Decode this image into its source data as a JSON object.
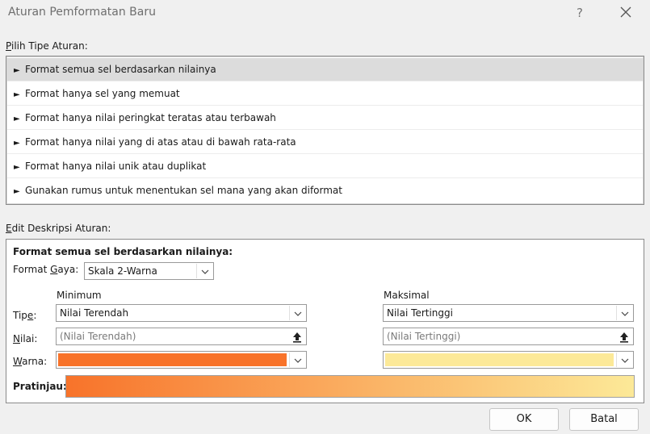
{
  "window": {
    "title": "Aturan Pemformatan Baru",
    "help_label": "?"
  },
  "rule_type": {
    "label_accel": "P",
    "label_rest": "ilih Tipe Aturan:",
    "items": [
      {
        "label": "Format semua sel berdasarkan nilainya",
        "selected": true
      },
      {
        "label": "Format hanya sel yang memuat",
        "selected": false
      },
      {
        "label": "Format hanya nilai peringkat teratas atau terbawah",
        "selected": false
      },
      {
        "label": "Format hanya nilai yang di atas atau di bawah rata-rata",
        "selected": false
      },
      {
        "label": "Format hanya nilai unik atau duplikat",
        "selected": false
      },
      {
        "label": "Gunakan rumus untuk menentukan sel mana yang akan diformat",
        "selected": false
      }
    ],
    "arrow_glyph": "►"
  },
  "description": {
    "label_accel": "E",
    "label_rest": "dit Deskripsi Aturan:",
    "heading": "Format semua sel berdasarkan nilainya:",
    "format_style_label_pre": "Format ",
    "format_style_label_accel": "G",
    "format_style_label_post": "aya:",
    "format_style_value": "Skala 2-Warna",
    "minimum_header": "Minimum",
    "maximum_header": "Maksimal",
    "type_label_pre": "Tip",
    "type_label_accel": "e",
    "type_label_post": ":",
    "value_label_accel": "N",
    "value_label_post": "ilai:",
    "color_label_accel": "W",
    "color_label_post": "arna:",
    "min_type": "Nilai Terendah",
    "max_type": "Nilai Tertinggi",
    "min_value_placeholder": "(Nilai Terendah)",
    "max_value_placeholder": "(Nilai Tertinggi)",
    "min_color": "#f8732a",
    "max_color": "#fce998",
    "preview_label": "Pratinjau:"
  },
  "buttons": {
    "ok": "OK",
    "cancel": "Batal"
  }
}
